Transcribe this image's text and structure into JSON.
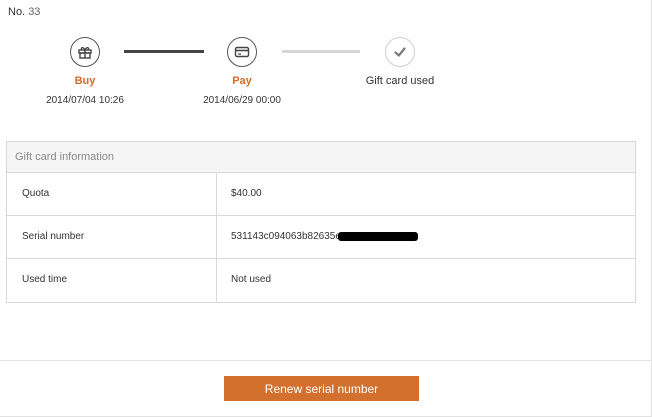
{
  "order": {
    "label": "No.",
    "number": "33"
  },
  "steps": [
    {
      "name": "Buy",
      "time": "2014/07/04 10:26",
      "icon": "gift-icon"
    },
    {
      "name": "Pay",
      "time": "2014/06/29 00:00",
      "icon": "credit-card-icon"
    },
    {
      "name": "Gift card used",
      "time": "",
      "icon": "check-icon"
    }
  ],
  "colors": {
    "accent": "#d4702e",
    "step_done_line": "#444444",
    "step_pending_line": "#d6d6d6"
  },
  "gift_card": {
    "title": "Gift card information",
    "rows": [
      {
        "label": "Quota",
        "value": "$40.00"
      },
      {
        "label": "Serial number",
        "value": "531143c094063b82635ea59c"
      },
      {
        "label": "Used time",
        "value": "Not used"
      }
    ]
  },
  "actions": {
    "renew_label": "Renew serial number"
  }
}
